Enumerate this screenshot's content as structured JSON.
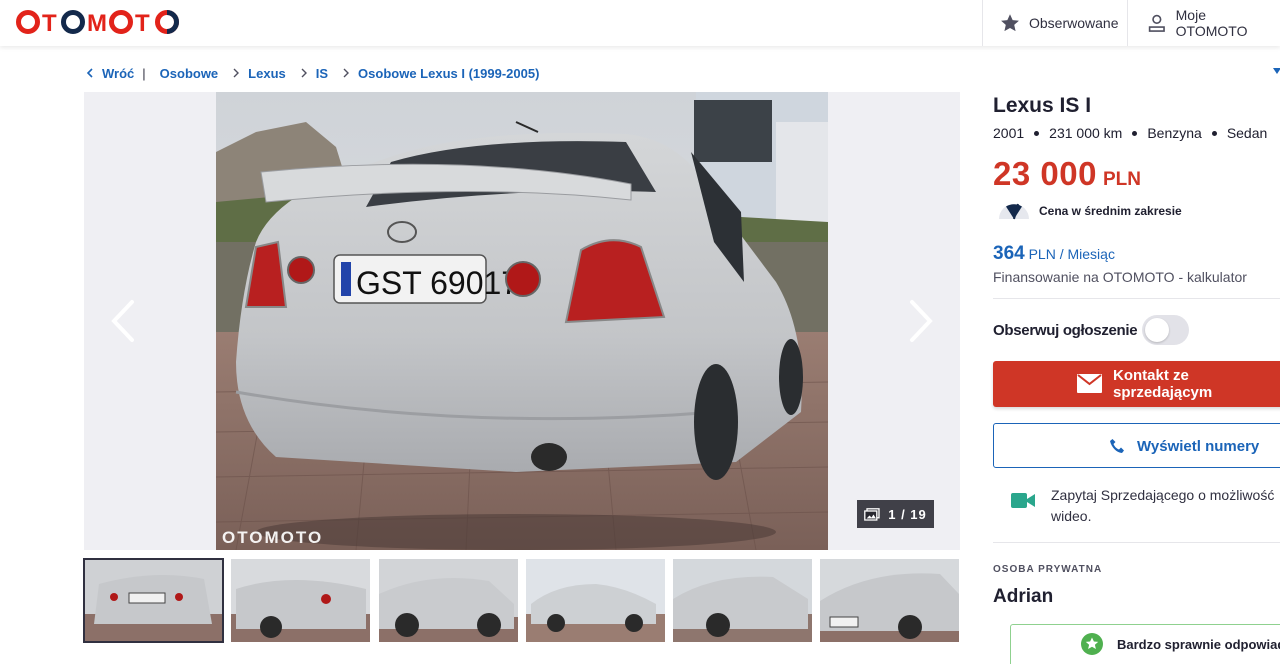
{
  "header": {
    "logo_text": "OTOMOTO",
    "watchlist_label": "Obserwowane",
    "account_label": "Moje OTOMOTO",
    "brand_red": "#e2231a",
    "brand_navy": "#13294b"
  },
  "breadcrumb": {
    "back_label": "Wróć",
    "items": [
      "Osobowe",
      "Lexus",
      "IS",
      "Osobowe Lexus I (1999-2005)"
    ]
  },
  "gallery": {
    "counter": "1 / 19",
    "watermark": "OTOMOTO",
    "thumbnail_count": 6
  },
  "listing": {
    "title": "Lexus IS I",
    "year": "2001",
    "mileage": "231 000 km",
    "fuel": "Benzyna",
    "body": "Sedan",
    "price_amount": "23 000",
    "price_currency": "PLN",
    "price_evaluation": "Cena w średnim zakresie",
    "installment_amount": "364",
    "installment_unit": "PLN / Miesiąc",
    "financing_label": "Finansowanie na OTOMOTO - kalkulator",
    "observe_label": "Obserwuj ogłoszenie",
    "observe_on": false,
    "contact_button": "Kontakt ze sprzedającym",
    "phone_button": "Wyświetl numery",
    "video_question": "Zapytaj Sprzedającego o możliwość wideo.",
    "seller_type": "OSOBA PRYWATNA",
    "seller_name": "Adrian",
    "seller_badge": "Bardzo sprawnie odpowiada"
  },
  "colors": {
    "price_red": "#cf3626",
    "link_blue": "#1b64b8",
    "video_green": "#2aa68c"
  },
  "icons": [
    "star-icon",
    "user-icon",
    "chevron-left-icon",
    "chevron-right-icon",
    "gallery-icon",
    "mail-icon",
    "phone-icon",
    "video-icon",
    "price-gauge-icon"
  ]
}
